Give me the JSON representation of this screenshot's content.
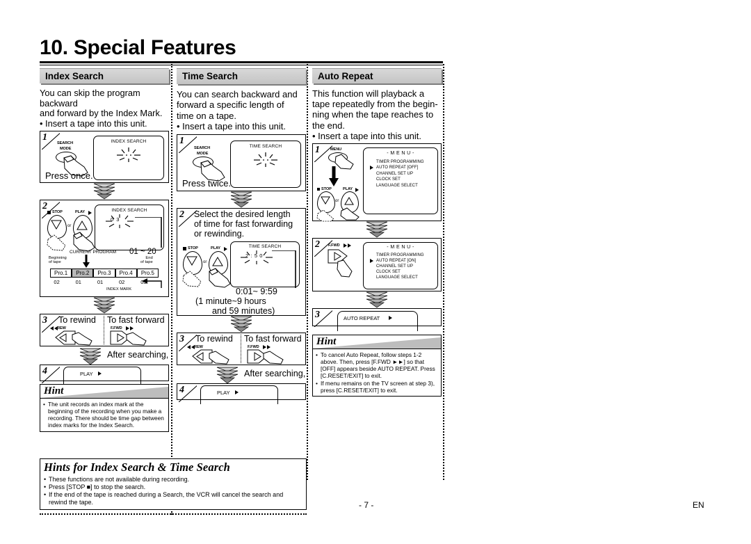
{
  "page": {
    "title": "10. Special Features",
    "page_number": "- 7 -",
    "language_code": "EN"
  },
  "index_search": {
    "heading": "Index Search",
    "intro_line1": "You can skip the program backward",
    "intro_line2": "and forward by the Index Mark.",
    "bullet": "• Insert a tape into this unit.",
    "step1": {
      "number": "1",
      "button_label_top": "SEARCH",
      "button_label_bottom": "MODE",
      "osd_title": "INDEX SEARCH",
      "caption": "Press once."
    },
    "step2": {
      "number": "2",
      "button_stop": "STOP",
      "button_play": "PLAY",
      "or": "or",
      "osd_title": "INDEX SEARCH",
      "osd_value": "0 3",
      "range": "01 ~ 20",
      "current_program": "CURRENT PROGRAM",
      "beginning_of_tape_l1": "Beginning",
      "beginning_of_tape_l2": "of tape",
      "end_of_tape_l1": "End",
      "end_of_tape_l2": "of tape",
      "programs": [
        "Pro.1",
        "Pro.2",
        "Pro.3",
        "Pro.4",
        "Pro.5"
      ],
      "current_index": 1,
      "marks": [
        "02",
        "01",
        "01",
        "02",
        "03"
      ],
      "index_mark_label": "INDEX MARK"
    },
    "step3": {
      "number": "3",
      "to_rewind": "To rewind",
      "to_fast_forward": "To fast forward",
      "rew_label": "REW",
      "ffwd_label": "F.FWD"
    },
    "after_searching": "After searching,",
    "step4": {
      "number": "4",
      "play_label": "PLAY"
    },
    "hint": {
      "title": "Hint",
      "items": [
        "The unit records an index mark at the beginning of the recording when you make a recording. There should be time gap between index marks for the Index Search."
      ]
    }
  },
  "time_search": {
    "heading": "Time Search",
    "intro_line1": "You can search backward and",
    "intro_line2": "forward a specific length of",
    "intro_line3": "time on a tape.",
    "bullet": "• Insert a tape into this unit.",
    "step1": {
      "number": "1",
      "button_label_top": "SEARCH",
      "button_label_bottom": "MODE",
      "osd_title": "TIME SEARCH",
      "caption": "Press twice."
    },
    "step2": {
      "number": "2",
      "instruction_l1": "Select the desired length",
      "instruction_l2": "of time for fast forwarding",
      "instruction_l3": "or rewinding.",
      "button_stop": "STOP",
      "button_play": "PLAY",
      "or": "or",
      "osd_title": "TIME SEARCH",
      "osd_value": "2 : 5 0",
      "range": "0:01~ 9:59",
      "range_note_l1": "(1 minute~9 hours",
      "range_note_l2": "and 59 minutes)"
    },
    "step3": {
      "number": "3",
      "to_rewind": "To rewind",
      "to_fast_forward": "To fast forward",
      "rew_label": "REW",
      "ffwd_label": "F.FWD"
    },
    "after_searching": "After searching,",
    "step4": {
      "number": "4",
      "play_label": "PLAY"
    }
  },
  "auto_repeat": {
    "heading": "Auto Repeat",
    "intro_line1": "This function will playback a",
    "intro_line2": "tape repeatedly from the begin-",
    "intro_line3": "ning when the tape reaches to",
    "intro_line4": "the end.",
    "bullet": "• Insert a tape into this unit.",
    "step1": {
      "number": "1",
      "menu_button": "MENU",
      "button_stop": "STOP",
      "button_play": "PLAY",
      "or": "or",
      "osd_title": "- M E N U -",
      "menu_items": [
        "TIMER PROGRAMMING",
        "AUTO REPEAT  [OFF]",
        "CHANNEL SET UP",
        "CLOCK SET",
        "LANGUAGE SELECT"
      ],
      "cursor_index": 1
    },
    "step2": {
      "number": "2",
      "button_ffwd": "F.FWD",
      "osd_title": "- M E N U -",
      "menu_items": [
        "TIMER PROGRAMMING",
        "AUTO REPEAT  [ON]",
        "CHANNEL SET UP",
        "CLOCK SET",
        "LANGUAGE SELECT"
      ],
      "cursor_index": 1
    },
    "step3": {
      "number": "3",
      "label": "AUTO REPEAT"
    },
    "hint": {
      "title": "Hint",
      "items": [
        "To cancel Auto Repeat, follow steps 1-2 above. Then, press [F.FWD ►►] so that [OFF] appears beside AUTO REPEAT. Press [C.RESET/EXIT] to exit.",
        "If menu remains on the TV screen at step 3), press [C.RESET/EXIT] to exit."
      ]
    }
  },
  "hints_combined": {
    "title": "Hints for Index Search & Time Search",
    "items": [
      "These functions are not available during recording.",
      "Press [STOP ■] to stop the search.",
      "If the end of the tape is reached during a Search, the VCR will cancel the search and rewind the tape."
    ]
  }
}
